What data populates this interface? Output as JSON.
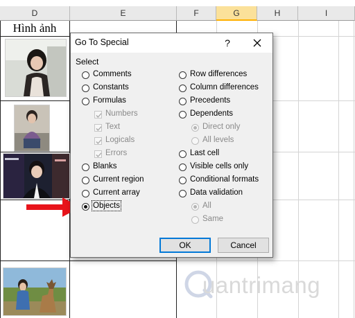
{
  "sheet": {
    "columns": [
      {
        "label": "D",
        "selected": false
      },
      {
        "label": "E",
        "selected": false
      },
      {
        "label": "F",
        "selected": false
      },
      {
        "label": "G",
        "selected": true
      },
      {
        "label": "H",
        "selected": false
      },
      {
        "label": "I",
        "selected": false
      }
    ],
    "cell_title": "Hình ảnh"
  },
  "dialog": {
    "title": "Go To Special",
    "help_label": "?",
    "group_label": "Select",
    "left_options": [
      {
        "label": "Comments",
        "type": "radio",
        "checked": false,
        "disabled": false
      },
      {
        "label": "Constants",
        "type": "radio",
        "checked": false,
        "disabled": false
      },
      {
        "label": "Formulas",
        "type": "radio",
        "checked": false,
        "disabled": false
      },
      {
        "label": "Numbers",
        "type": "checkbox",
        "checked": true,
        "disabled": true
      },
      {
        "label": "Text",
        "type": "checkbox",
        "checked": true,
        "disabled": true
      },
      {
        "label": "Logicals",
        "type": "checkbox",
        "checked": true,
        "disabled": true
      },
      {
        "label": "Errors",
        "type": "checkbox",
        "checked": true,
        "disabled": true
      },
      {
        "label": "Blanks",
        "type": "radio",
        "checked": false,
        "disabled": false
      },
      {
        "label": "Current region",
        "type": "radio",
        "checked": false,
        "disabled": false
      },
      {
        "label": "Current array",
        "type": "radio",
        "checked": false,
        "disabled": false
      },
      {
        "label": "Objects",
        "type": "radio",
        "checked": true,
        "disabled": false
      }
    ],
    "right_options": [
      {
        "label": "Row differences",
        "type": "radio",
        "checked": false,
        "disabled": false
      },
      {
        "label": "Column differences",
        "type": "radio",
        "checked": false,
        "disabled": false
      },
      {
        "label": "Precedents",
        "type": "radio",
        "checked": false,
        "disabled": false
      },
      {
        "label": "Dependents",
        "type": "radio",
        "checked": false,
        "disabled": false
      },
      {
        "label": "Direct only",
        "type": "radio",
        "checked": true,
        "disabled": true
      },
      {
        "label": "All levels",
        "type": "radio",
        "checked": false,
        "disabled": true
      },
      {
        "label": "Last cell",
        "type": "radio",
        "checked": false,
        "disabled": false
      },
      {
        "label": "Visible cells only",
        "type": "radio",
        "checked": false,
        "disabled": false
      },
      {
        "label": "Conditional formats",
        "type": "radio",
        "checked": false,
        "disabled": false
      },
      {
        "label": "Data validation",
        "type": "radio",
        "checked": false,
        "disabled": false
      },
      {
        "label": "All",
        "type": "radio",
        "checked": true,
        "disabled": true
      },
      {
        "label": "Same",
        "type": "radio",
        "checked": false,
        "disabled": true
      }
    ],
    "ok_label": "OK",
    "cancel_label": "Cancel"
  },
  "annotation": {
    "arrow_color": "#e8141b"
  },
  "watermark": {
    "text": "uantrimang"
  }
}
